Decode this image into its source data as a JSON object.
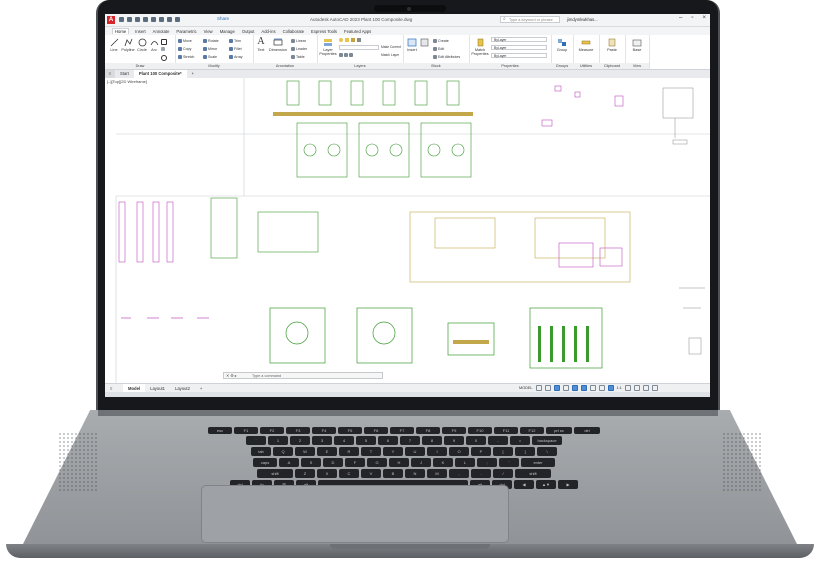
{
  "titlebar": {
    "share_label": "Share",
    "document_title": "Autodesk AutoCAD 2023   Plant 100 Composite.dwg",
    "search_placeholder": "Type a keyword or phrase",
    "user_label": "jimdymkwkhas..."
  },
  "ribbon_tabs": [
    "Home",
    "Insert",
    "Annotate",
    "Parametric",
    "View",
    "Manage",
    "Output",
    "Add-ins",
    "Collaborate",
    "Express Tools",
    "Featured Apps"
  ],
  "ribbon": {
    "draw": {
      "title": "Draw",
      "tools": [
        "Line",
        "Polyline",
        "Circle",
        "Arc"
      ]
    },
    "modify": {
      "title": "Modify",
      "tools": [
        "Move",
        "Rotate",
        "Trim",
        "Copy",
        "Mirror",
        "Fillet",
        "Stretch",
        "Scale",
        "Array"
      ]
    },
    "annotation": {
      "title": "Annotation",
      "tools": [
        "Text",
        "Dimension",
        "Linear",
        "Leader",
        "Table"
      ]
    },
    "layers": {
      "title": "Layers",
      "tools": [
        "Layer Properties",
        "Make Current",
        "Match Layer"
      ]
    },
    "block": {
      "title": "Block",
      "tools": [
        "Insert",
        "Create",
        "Edit",
        "Edit Attributes"
      ]
    },
    "properties": {
      "title": "Properties",
      "tools": [
        "Match Properties",
        "ByLayer",
        "ByLayer",
        "ByLayer"
      ]
    },
    "groups": {
      "title": "Groups",
      "tools": [
        "Group"
      ]
    },
    "utilities": {
      "title": "Utilities",
      "tools": [
        "Measure"
      ]
    },
    "clipboard": {
      "title": "Clipboard",
      "tools": [
        "Paste"
      ]
    },
    "view": {
      "title": "View",
      "tools": [
        "Base"
      ]
    }
  },
  "file_tabs": {
    "start": "Start",
    "active": "Plant 100 Composite*",
    "add": "+"
  },
  "viewport": {
    "label": "[–][Top][2D Wireframe]"
  },
  "command_line": {
    "placeholder": "Type a command"
  },
  "statusbar": {
    "layout_tabs": [
      "Model",
      "Layout1",
      "Layout2"
    ],
    "add": "+",
    "mode": "MODEL",
    "scale": "1:1"
  },
  "keyboard": {
    "rows": [
      [
        "esc",
        "F1",
        "F2",
        "F3",
        "F4",
        "F5",
        "F6",
        "F7",
        "F8",
        "F9",
        "F10",
        "F11",
        "F12",
        "prt sc",
        "del"
      ],
      [
        "`",
        "1",
        "2",
        "3",
        "4",
        "5",
        "6",
        "7",
        "8",
        "9",
        "0",
        "-",
        "=",
        "backspace"
      ],
      [
        "tab",
        "Q",
        "W",
        "E",
        "R",
        "T",
        "Y",
        "U",
        "I",
        "O",
        "P",
        "[",
        "]",
        "\\"
      ],
      [
        "caps",
        "A",
        "S",
        "D",
        "F",
        "G",
        "H",
        "J",
        "K",
        "L",
        ";",
        "'",
        "enter"
      ],
      [
        "shift",
        "Z",
        "X",
        "C",
        "V",
        "B",
        "N",
        "M",
        ",",
        ".",
        "/",
        "shift"
      ],
      [
        "ctrl",
        "fn",
        "⊞",
        "alt",
        "",
        "alt",
        "ctrl",
        "◀",
        "▲▼",
        "▶"
      ]
    ]
  },
  "colors": {
    "app_red": "#d6262c",
    "drawing_green": "#3a9a2e",
    "drawing_magenta": "#c04dbf",
    "accent_blue": "#2f6fb7"
  }
}
